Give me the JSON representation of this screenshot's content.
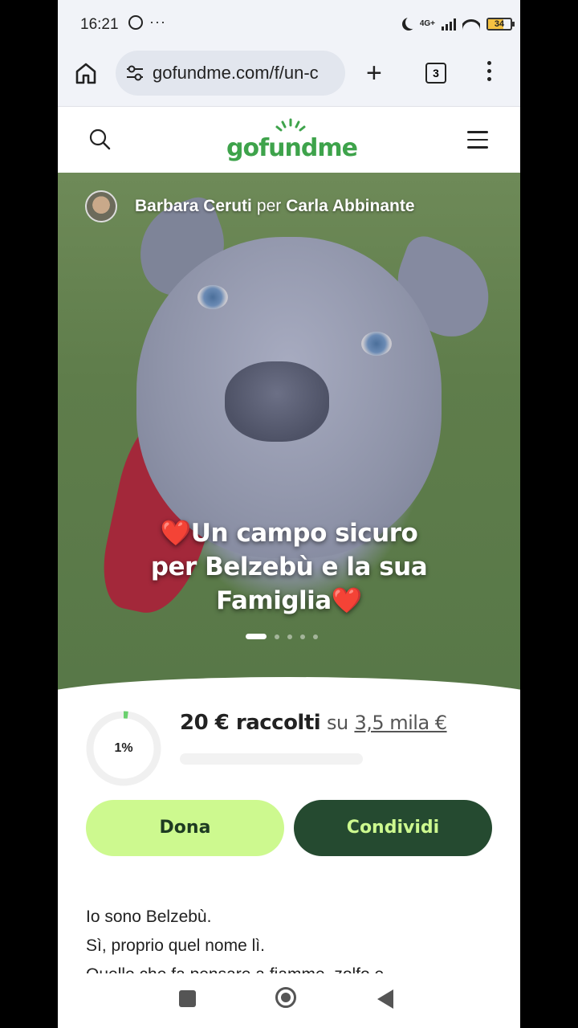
{
  "status_bar": {
    "time": "16:21",
    "dots": "···",
    "network": "4G+",
    "battery": "34"
  },
  "browser": {
    "url": "gofundme.com/f/un-c",
    "tab_count": "3"
  },
  "site": {
    "logo": "gofundme"
  },
  "hero": {
    "organizer": "Barbara Ceruti",
    "per": "per",
    "beneficiary": "Carla Abbinante",
    "title_heart": "❤️",
    "title_line1": "Un campo sicuro",
    "title_line2": "per Belzebù e la sua",
    "title_line3": "Famiglia",
    "slide_count": 5,
    "active_slide": 1
  },
  "fundraiser": {
    "percent": "1%",
    "progress_fraction": 0.01,
    "raised": "20 € raccolti",
    "su": "su",
    "goal": "3,5 mila €"
  },
  "actions": {
    "donate": "Dona",
    "share": "Condividi"
  },
  "colors": {
    "brand_green": "#3ea34b",
    "donate_bg": "#cdf98f",
    "share_bg": "#254a30"
  },
  "story": {
    "lines": [
      "Io sono Belzebù.",
      "Sì, proprio quel nome lì.",
      "Quello che fa pensare a fiamme, zolfo e"
    ]
  }
}
